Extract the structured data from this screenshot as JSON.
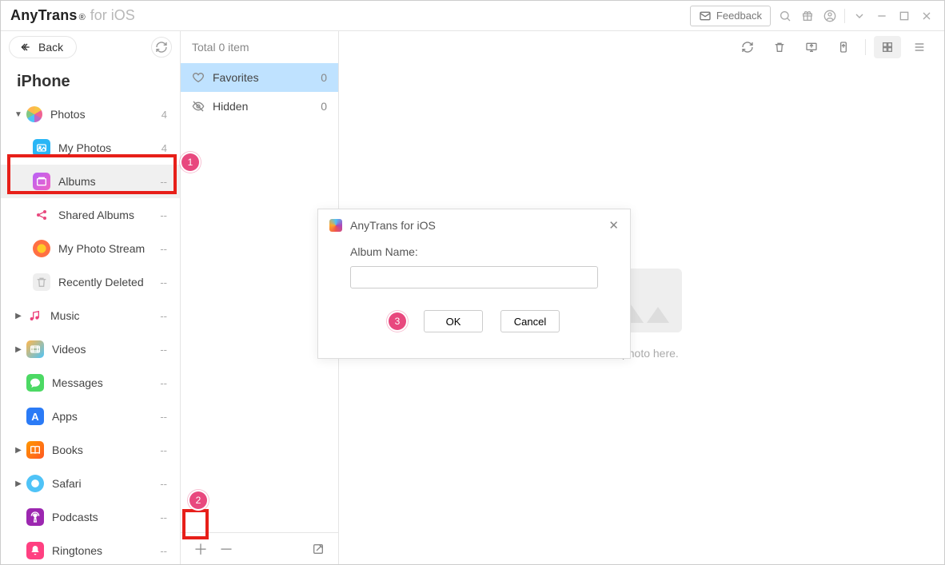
{
  "titlebar": {
    "brand_bold": "AnyTrans",
    "brand_reg": "®",
    "brand_suffix": "for iOS",
    "feedback": "Feedback"
  },
  "sidebar": {
    "back": "Back",
    "device": "iPhone",
    "items": [
      {
        "label": "Photos",
        "count": "4",
        "icon": "photos"
      },
      {
        "label": "My Photos",
        "count": "4",
        "icon": "myphotos"
      },
      {
        "label": "Albums",
        "count": "--",
        "icon": "albums"
      },
      {
        "label": "Shared Albums",
        "count": "--",
        "icon": "shared"
      },
      {
        "label": "My Photo Stream",
        "count": "--",
        "icon": "stream"
      },
      {
        "label": "Recently Deleted",
        "count": "--",
        "icon": "deleted"
      },
      {
        "label": "Music",
        "count": "--",
        "icon": "music"
      },
      {
        "label": "Videos",
        "count": "--",
        "icon": "videos"
      },
      {
        "label": "Messages",
        "count": "--",
        "icon": "messages"
      },
      {
        "label": "Apps",
        "count": "--",
        "icon": "apps"
      },
      {
        "label": "Books",
        "count": "--",
        "icon": "books"
      },
      {
        "label": "Safari",
        "count": "--",
        "icon": "safari"
      },
      {
        "label": "Podcasts",
        "count": "--",
        "icon": "podcasts"
      },
      {
        "label": "Ringtones",
        "count": "--",
        "icon": "ringtones"
      }
    ]
  },
  "midcol": {
    "summary": "Total 0 item",
    "rows": [
      {
        "label": "Favorites",
        "count": "0"
      },
      {
        "label": "Hidden",
        "count": "0"
      }
    ]
  },
  "content": {
    "empty_text": "No photo here."
  },
  "dialog": {
    "title": "AnyTrans for iOS",
    "field_label": "Album Name:",
    "ok": "OK",
    "cancel": "Cancel"
  },
  "steps": {
    "s1": "1",
    "s2": "2",
    "s3": "3"
  }
}
